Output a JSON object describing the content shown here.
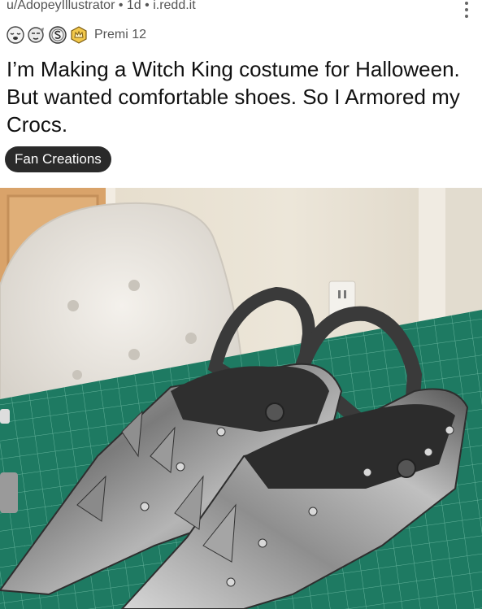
{
  "post": {
    "meta_line": "u/AdopeyIllustrator • 1d • i.redd.it",
    "award_label": "Premi 12",
    "title": "I’m Making a Witch King costume for Halloween. But wanted comfortable shoes. So I Armored my Crocs.",
    "flair": "Fan Creations"
  },
  "awards": [
    "sleepy-face-icon",
    "face-icon",
    "silver-s-coin-icon",
    "gold-crown-icon"
  ],
  "icons": {
    "more": "vertical-dots-icon"
  },
  "colors": {
    "flair_bg": "#2a2a2a",
    "mat_green": "#1f7a63",
    "wall": "#e8e2d6"
  }
}
